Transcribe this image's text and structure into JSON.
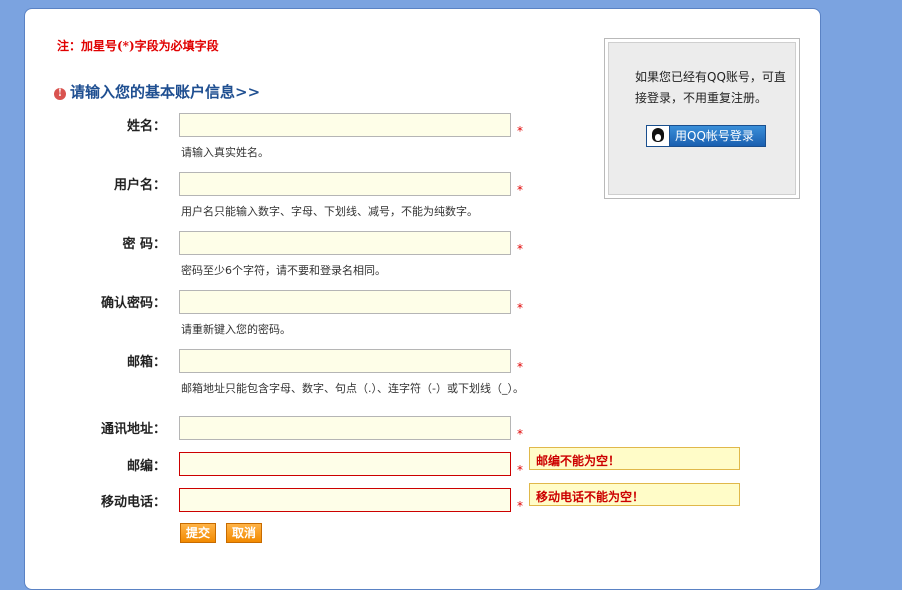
{
  "note": "注：加星号(*)字段为必填字段",
  "section_title": "请输入您的基本账户信息>>",
  "required_mark": "*",
  "fields": {
    "name": {
      "label": "姓名：",
      "value": "",
      "hint": "请输入真实姓名。"
    },
    "username": {
      "label": "用户名：",
      "value": "",
      "hint": "用户名只能输入数字、字母、下划线、减号，不能为纯数字。"
    },
    "password": {
      "label": "密 码：",
      "value": "",
      "hint": "密码至少6个字符，请不要和登录名相同。"
    },
    "confirm": {
      "label": "确认密码：",
      "value": "",
      "hint": "请重新键入您的密码。"
    },
    "email": {
      "label": "邮箱：",
      "value": "",
      "hint": "邮箱地址只能包含字母、数字、句点（.）、连字符（-）或下划线（_）。"
    },
    "address": {
      "label": "通讯地址：",
      "value": ""
    },
    "zip": {
      "label": "邮编：",
      "value": "",
      "error": "邮编不能为空！"
    },
    "mobile": {
      "label": "移动电话：",
      "value": "",
      "error": "移动电话不能为空！"
    }
  },
  "buttons": {
    "submit": "提交",
    "cancel": "取消"
  },
  "qq": {
    "text": "如果您已经有QQ账号，可直接登录，不用重复注册。",
    "button": "用QQ帐号登录"
  },
  "colors": {
    "background": "#7ba3e0",
    "required": "#e00000",
    "title": "#1f4f91",
    "input_bg": "#fefee8",
    "button": "#f28a00"
  }
}
